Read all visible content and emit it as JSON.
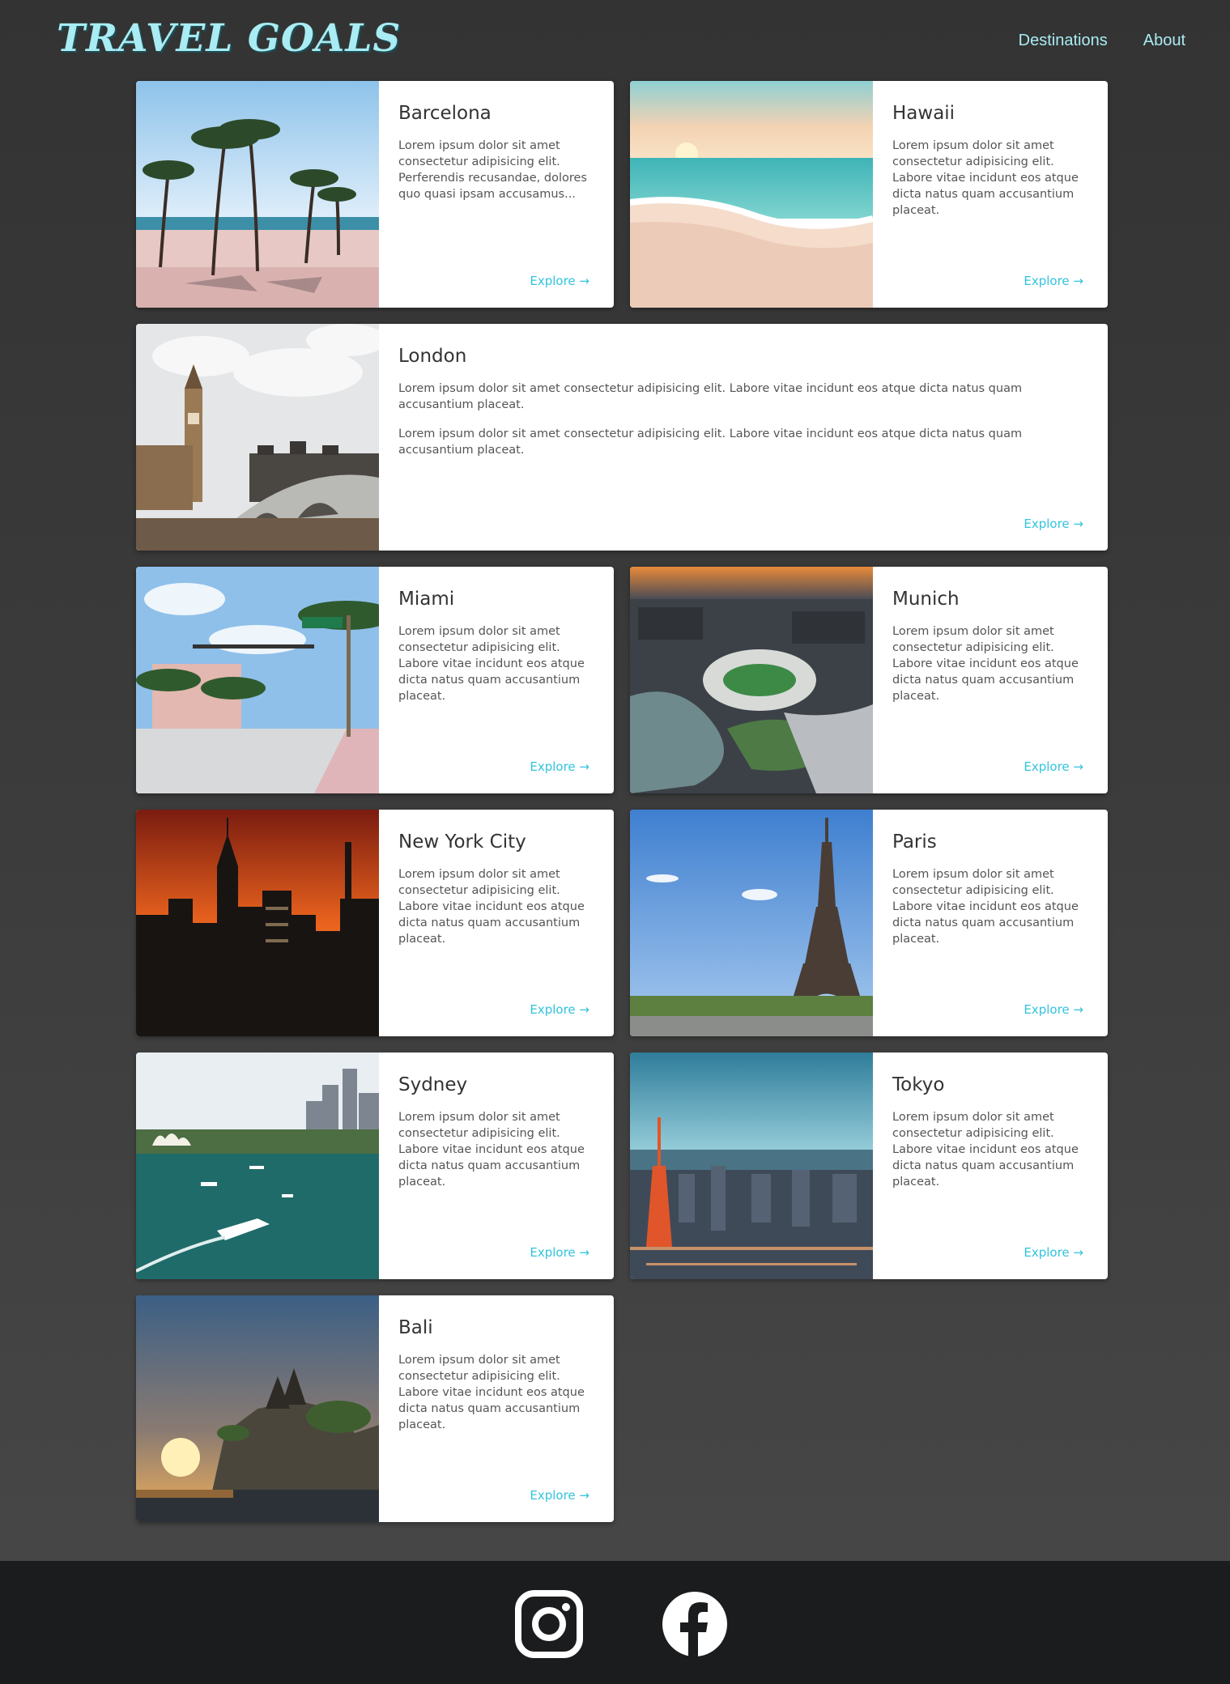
{
  "header": {
    "logo": "TRAVEL GOALS",
    "nav": [
      "Destinations",
      "About"
    ]
  },
  "cards": [
    {
      "title": "Barcelona",
      "text": "Lorem ipsum dolor sit amet consectetur adipisicing elit. Perferendis recusandae, dolores quo quasi ipsam accusamus...",
      "link": "Explore →"
    },
    {
      "title": "Hawaii",
      "text": "Lorem ipsum dolor sit amet consectetur adipisicing elit. Labore vitae incidunt eos atque dicta natus quam accusantium placeat.",
      "link": "Explore →"
    },
    {
      "title": "London",
      "text": "Lorem ipsum dolor sit amet consectetur adipisicing elit. Labore vitae incidunt eos atque dicta natus quam accusantium placeat.",
      "text2": "Lorem ipsum dolor sit amet consectetur adipisicing elit. Labore vitae incidunt eos atque dicta natus quam accusantium placeat.",
      "link": "Explore →"
    },
    {
      "title": "Miami",
      "text": "Lorem ipsum dolor sit amet consectetur adipisicing elit. Labore vitae incidunt eos atque dicta natus quam accusantium placeat.",
      "link": "Explore →"
    },
    {
      "title": "Munich",
      "text": "Lorem ipsum dolor sit amet consectetur adipisicing elit. Labore vitae incidunt eos atque dicta natus quam accusantium placeat.",
      "link": "Explore →"
    },
    {
      "title": "New York City",
      "text": "Lorem ipsum dolor sit amet consectetur adipisicing elit. Labore vitae incidunt eos atque dicta natus quam accusantium placeat.",
      "link": "Explore →"
    },
    {
      "title": "Paris",
      "text": "Lorem ipsum dolor sit amet consectetur adipisicing elit. Labore vitae incidunt eos atque dicta natus quam accusantium placeat.",
      "link": "Explore →"
    },
    {
      "title": "Sydney",
      "text": "Lorem ipsum dolor sit amet consectetur adipisicing elit. Labore vitae incidunt eos atque dicta natus quam accusantium placeat.",
      "link": "Explore →"
    },
    {
      "title": "Tokyo",
      "text": "Lorem ipsum dolor sit amet consectetur adipisicing elit. Labore vitae incidunt eos atque dicta natus quam accusantium placeat.",
      "link": "Explore →"
    },
    {
      "title": "Bali",
      "text": "Lorem ipsum dolor sit amet consectetur adipisicing elit. Labore vitae incidunt eos atque dicta natus quam accusantium placeat.",
      "link": "Explore →"
    }
  ],
  "footer": {
    "icons": [
      "instagram-icon",
      "facebook-icon"
    ]
  },
  "colors": {
    "accent": "#a9ecf3",
    "link": "#33c3dd",
    "footer": "#1b1c1d"
  }
}
